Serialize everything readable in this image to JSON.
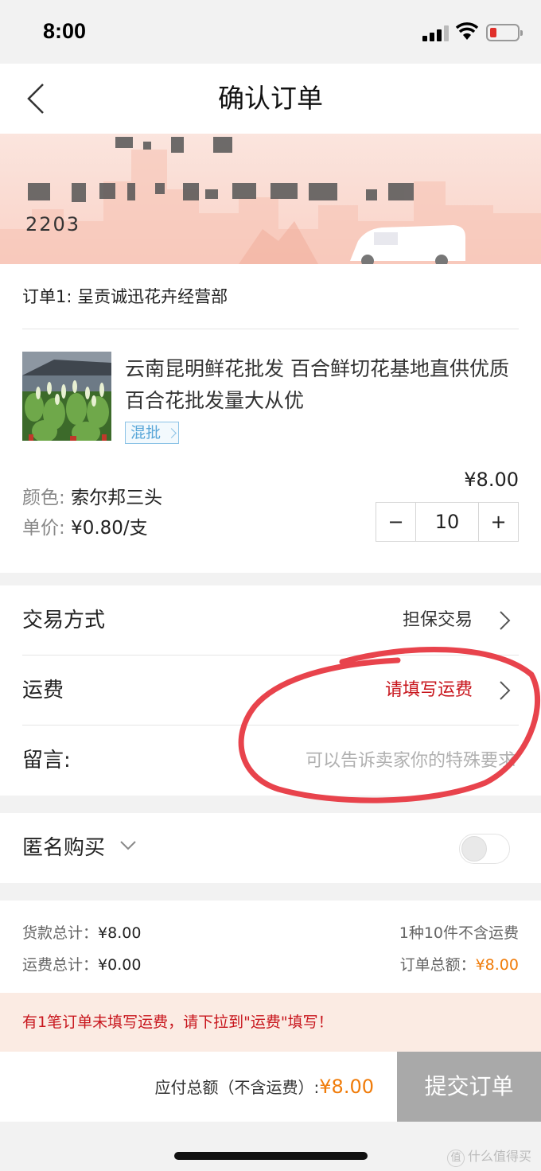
{
  "status_bar": {
    "time": "8:00"
  },
  "nav": {
    "title": "确认订单"
  },
  "address": {
    "line1": "▪ ▪ ▪ ▪",
    "line2": "▮▮▮▮ ▮ ▮▮ ▮▮▮ ▮▮▮ ▮▮",
    "line3": "2203"
  },
  "order": {
    "store_label": "订单1: 呈贡诚迅花卉经营部",
    "product_title": "云南昆明鲜花批发 百合鲜切花基地直供优质百合花批发量大从优",
    "tag": "混批",
    "color_key": "颜色:",
    "color_value": "索尔邦三头",
    "unit_price_key": "单价:",
    "unit_price_value": "¥0.80/支",
    "price": "¥8.00",
    "quantity": "10",
    "minus": "−",
    "plus": "+"
  },
  "options": {
    "trade_label": "交易方式",
    "trade_value": "担保交易",
    "shipping_label": "运费",
    "shipping_value": "请填写运费",
    "message_label": "留言:",
    "message_placeholder": "可以告诉卖家你的特殊要求"
  },
  "anonymous": {
    "label": "匿名购买",
    "enabled": false
  },
  "summary": {
    "goods_total_key": "货款总计：",
    "goods_total_value": "¥8.00",
    "shipping_total_key": "运费总计：",
    "shipping_total_value": "¥0.00",
    "items_note": "1种10件不含运费",
    "order_total_key": "订单总额：",
    "order_total_value": "¥8.00"
  },
  "warning": {
    "text": "有1笔订单未填写运费，请下拉到\"运费\"填写！"
  },
  "bottom": {
    "total_key": "应付总额（不含运费）:",
    "total_value": "¥8.00",
    "submit_label": "提交订单"
  },
  "watermark": {
    "badge": "值",
    "text": "什么值得买"
  },
  "colors": {
    "accent_red": "#c8161d",
    "price_orange": "#f07c0a",
    "disabled_button": "#a9a9a9"
  }
}
